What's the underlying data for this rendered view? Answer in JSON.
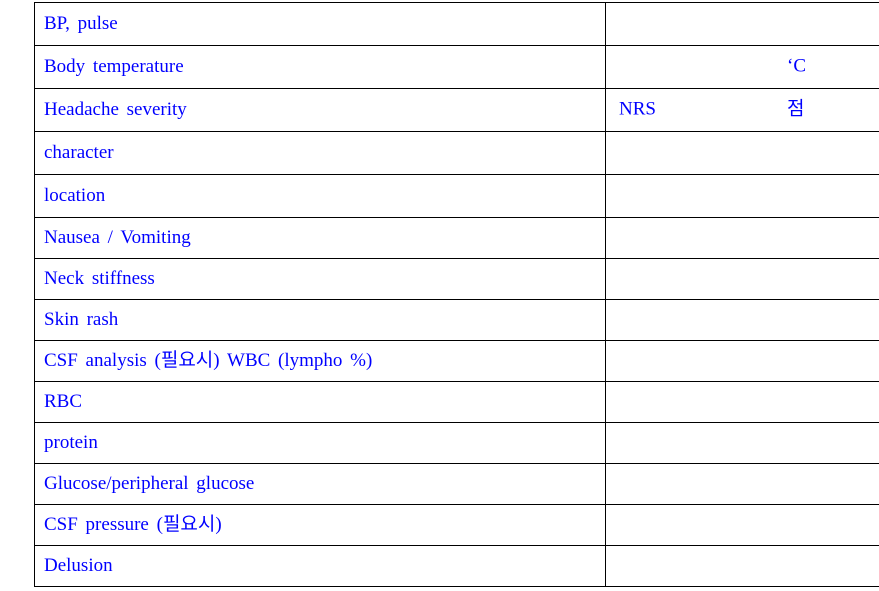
{
  "document": {
    "type": "clinical-assessment-form-table",
    "text_color": "#0000ff",
    "border_color": "#000000",
    "background_color": "#ffffff",
    "column_count": 2
  },
  "table": {
    "rows": [
      {
        "label": "BP,  pulse",
        "indent": "none",
        "value_left": "",
        "value_right": ""
      },
      {
        "label": "Body  temperature",
        "indent": "none",
        "value_left": "",
        "value_right": "‘C"
      },
      {
        "label": "Headache  severity",
        "indent": "none",
        "value_left": "NRS",
        "value_right": "점"
      },
      {
        "label": "character",
        "indent": "indent-1",
        "value_left": "",
        "value_right": ""
      },
      {
        "label": "location",
        "indent": "indent-1",
        "value_left": "",
        "value_right": ""
      },
      {
        "label": "Nausea  /  Vomiting",
        "indent": "none",
        "value_left": "",
        "value_right": ""
      },
      {
        "label": "Neck  stiffness",
        "indent": "none",
        "value_left": "",
        "value_right": ""
      },
      {
        "label": "Skin  rash",
        "indent": "none",
        "value_left": "",
        "value_right": ""
      },
      {
        "label": "CSF  analysis  (필요시)  WBC     (lympho  %)",
        "indent": "none",
        "value_left": "",
        "value_right": ""
      },
      {
        "label": "RBC",
        "indent": "indent-2",
        "value_left": "",
        "value_right": ""
      },
      {
        "label": "protein",
        "indent": "indent-2",
        "value_left": "",
        "value_right": ""
      },
      {
        "label": "Glucose/peripheral  glucose",
        "indent": "indent-3",
        "value_left": "",
        "value_right": ""
      },
      {
        "label": "CSF  pressure  (필요시)",
        "indent": "none",
        "value_left": "",
        "value_right": ""
      },
      {
        "label": "Delusion",
        "indent": "none",
        "value_left": "",
        "value_right": ""
      }
    ]
  }
}
